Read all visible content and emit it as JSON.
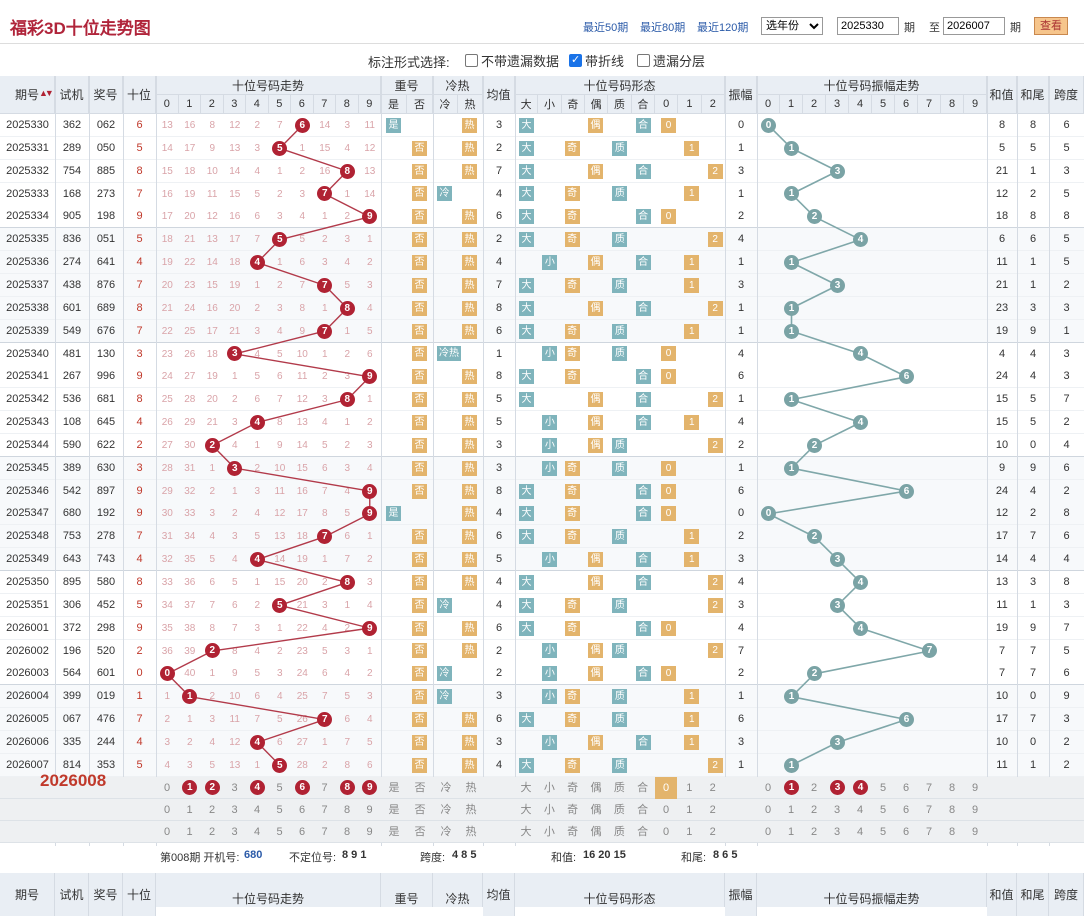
{
  "title": "福彩3D十位走势图",
  "quick_links": [
    "最近50期",
    "最近80期",
    "最近120期"
  ],
  "year_select": "选年份",
  "range": {
    "from": "2025330",
    "period_label": "期",
    "to_label": "至",
    "to": "2026007",
    "period_label2": "期"
  },
  "query_btn": "查看",
  "options": {
    "label": "标注形式选择:",
    "items": [
      {
        "label": "不带遗漏数据",
        "checked": false
      },
      {
        "label": "带折线",
        "checked": true
      },
      {
        "label": "遗漏分层",
        "checked": false
      }
    ]
  },
  "headers": {
    "period": "期号",
    "sort_icon": "sort-icon",
    "trial": "试机",
    "prize": "奖号",
    "tens": "十位",
    "trend": "十位号码走势",
    "repeat": "重号",
    "hotcold": "冷热",
    "avg": "均值",
    "shape": "十位号码形态",
    "amp": "振幅",
    "amptrend": "十位号码振幅走势",
    "sum": "和值",
    "sumtail": "和尾",
    "span": "跨度",
    "digits": [
      "0",
      "1",
      "2",
      "3",
      "4",
      "5",
      "6",
      "7",
      "8",
      "9"
    ],
    "repeat_sub": [
      "是",
      "否"
    ],
    "hotcold_sub": [
      "冷",
      "热"
    ],
    "shape_sub": [
      "大",
      "小",
      "奇",
      "偶",
      "质",
      "合",
      "0",
      "1",
      "2"
    ]
  },
  "rows": [
    {
      "p": "2025330",
      "t": "362",
      "z": "062",
      "d": 6,
      "tm": [
        13,
        16,
        8,
        12,
        2,
        7,
        0,
        14,
        3,
        11
      ],
      "rep": "是",
      "hc": "热",
      "av": 3,
      "big": "大",
      "bs": [
        0,
        2,
        7
      ],
      "oe": "偶",
      "oem": 7,
      "pc": "合",
      "pcm": 7,
      "r": "0",
      "rm": [
        0,
        2,
        3
      ],
      "amp": 0,
      "am": [
        0,
        6,
        1,
        7,
        2,
        2,
        14,
        11,
        10,
        24,
        55
      ],
      "sum": 8,
      "tail": 8,
      "span": 6
    },
    {
      "p": "2025331",
      "t": "289",
      "z": "050",
      "d": 5,
      "tm": [
        14,
        17,
        9,
        13,
        3,
        0,
        1,
        15,
        4,
        12
      ],
      "rep": "否",
      "hc": "热",
      "av": 2,
      "big": "大",
      "rz": "1",
      "amp": 1,
      "sum": 5,
      "tail": 5,
      "span": 5
    },
    {
      "p": "2025332",
      "t": "754",
      "z": "885",
      "d": 8,
      "tm": [
        15,
        18,
        10,
        14,
        4,
        1,
        2,
        16,
        0,
        13
      ],
      "rep": "否",
      "hc": "热",
      "av": 7,
      "big": "大",
      "rz": "2",
      "amp": 3,
      "sum": 21,
      "tail": 1,
      "span": 3
    },
    {
      "p": "2025333",
      "t": "168",
      "z": "273",
      "d": 7,
      "tm": [
        16,
        19,
        11,
        15,
        5,
        2,
        3,
        0,
        1,
        14
      ],
      "rep": "否",
      "hc": "冷",
      "av": 4,
      "big": "大",
      "rz": "1",
      "amp": 1,
      "sum": 12,
      "tail": 2,
      "span": 5
    },
    {
      "p": "2025334",
      "t": "905",
      "z": "198",
      "d": 9,
      "tm": [
        17,
        20,
        12,
        16,
        6,
        3,
        4,
        1,
        2,
        0
      ],
      "rep": "否",
      "hc": "热",
      "av": 6,
      "big": "大",
      "rz": "0",
      "amp": 2,
      "sum": 18,
      "tail": 8,
      "span": 8
    },
    {
      "p": "2025335",
      "t": "836",
      "z": "051",
      "d": 5,
      "tm": [
        18,
        21,
        13,
        17,
        7,
        0,
        5,
        2,
        3,
        1
      ],
      "rep": "否",
      "hc": "热",
      "av": 2,
      "big": "大",
      "rz": "2",
      "amp": 4,
      "sum": 6,
      "tail": 6,
      "span": 5
    },
    {
      "p": "2025336",
      "t": "274",
      "z": "641",
      "d": 4,
      "tm": [
        19,
        22,
        14,
        18,
        0,
        1,
        6,
        3,
        4,
        2
      ],
      "rep": "否",
      "hc": "热",
      "av": 4,
      "big": "小",
      "rz": "1",
      "amp": 1,
      "sum": 11,
      "tail": 1,
      "span": 5
    },
    {
      "p": "2025337",
      "t": "438",
      "z": "876",
      "d": 7,
      "tm": [
        20,
        23,
        15,
        19,
        1,
        2,
        7,
        0,
        5,
        3
      ],
      "rep": "否",
      "hc": "热",
      "av": 7,
      "big": "大",
      "rz": "1",
      "amp": 3,
      "sum": 21,
      "tail": 1,
      "span": 2
    },
    {
      "p": "2025338",
      "t": "601",
      "z": "689",
      "d": 8,
      "tm": [
        21,
        24,
        16,
        20,
        2,
        3,
        8,
        1,
        0,
        4
      ],
      "rep": "否",
      "hc": "热",
      "av": 8,
      "big": "大",
      "rz": "2",
      "amp": 1,
      "sum": 23,
      "tail": 3,
      "span": 3
    },
    {
      "p": "2025339",
      "t": "549",
      "z": "676",
      "d": 7,
      "tm": [
        22,
        25,
        17,
        21,
        3,
        4,
        9,
        0,
        1,
        5
      ],
      "rep": "否",
      "hc": "热",
      "av": 6,
      "big": "大",
      "rz": "1",
      "amp": 1,
      "sum": 19,
      "tail": 9,
      "span": 1
    },
    {
      "p": "2025340",
      "t": "481",
      "z": "130",
      "d": 3,
      "tm": [
        23,
        26,
        18,
        0,
        4,
        5,
        10,
        1,
        2,
        6
      ],
      "rep": "否",
      "hc": "冷热",
      "av": 1,
      "big": "小",
      "rz": "0",
      "amp": 4,
      "sum": 4,
      "tail": 4,
      "span": 3
    },
    {
      "p": "2025341",
      "t": "267",
      "z": "996",
      "d": 9,
      "tm": [
        24,
        27,
        19,
        1,
        5,
        6,
        11,
        2,
        3,
        0
      ],
      "rep": "否",
      "hc": "热",
      "av": 8,
      "big": "大",
      "rz": "0",
      "amp": 6,
      "sum": 24,
      "tail": 4,
      "span": 3
    },
    {
      "p": "2025342",
      "t": "536",
      "z": "681",
      "d": 8,
      "tm": [
        25,
        28,
        20,
        2,
        6,
        7,
        12,
        3,
        0,
        1
      ],
      "rep": "否",
      "hc": "热",
      "av": 5,
      "big": "大",
      "rz": "2",
      "amp": 1,
      "sum": 15,
      "tail": 5,
      "span": 7
    },
    {
      "p": "2025343",
      "t": "108",
      "z": "645",
      "d": 4,
      "tm": [
        26,
        29,
        21,
        3,
        0,
        8,
        13,
        4,
        1,
        2
      ],
      "rep": "否",
      "hc": "热",
      "av": 5,
      "big": "小",
      "rz": "1",
      "amp": 4,
      "sum": 15,
      "tail": 5,
      "span": 2
    },
    {
      "p": "2025344",
      "t": "590",
      "z": "622",
      "d": 2,
      "tm": [
        27,
        30,
        0,
        4,
        1,
        9,
        14,
        5,
        2,
        3
      ],
      "rep": "否",
      "hc": "热",
      "av": 3,
      "big": "小",
      "rz": "2",
      "amp": 2,
      "sum": 10,
      "tail": 0,
      "span": 4
    },
    {
      "p": "2025345",
      "t": "389",
      "z": "630",
      "d": 3,
      "tm": [
        28,
        31,
        1,
        0,
        2,
        10,
        15,
        6,
        3,
        4
      ],
      "rep": "否",
      "hc": "热",
      "av": 3,
      "big": "小",
      "rz": "0",
      "amp": 1,
      "sum": 9,
      "tail": 9,
      "span": 6
    },
    {
      "p": "2025346",
      "t": "542",
      "z": "897",
      "d": 9,
      "tm": [
        29,
        32,
        2,
        1,
        3,
        11,
        16,
        7,
        4,
        0
      ],
      "rep": "否",
      "hc": "热",
      "av": 8,
      "big": "大",
      "rz": "0",
      "amp": 6,
      "sum": 24,
      "tail": 4,
      "span": 2
    },
    {
      "p": "2025347",
      "t": "680",
      "z": "192",
      "d": 9,
      "tm": [
        30,
        33,
        3,
        2,
        4,
        12,
        17,
        8,
        5,
        0
      ],
      "rep": "是",
      "hc": "热",
      "av": 4,
      "big": "大",
      "rz": "0",
      "amp": 0,
      "sum": 12,
      "tail": 2,
      "span": 8
    },
    {
      "p": "2025348",
      "t": "753",
      "z": "278",
      "d": 7,
      "tm": [
        31,
        34,
        4,
        3,
        5,
        13,
        18,
        0,
        6,
        1
      ],
      "rep": "否",
      "hc": "热",
      "av": 6,
      "big": "大",
      "rz": "1",
      "amp": 2,
      "sum": 17,
      "tail": 7,
      "span": 6
    },
    {
      "p": "2025349",
      "t": "643",
      "z": "743",
      "d": 4,
      "tm": [
        32,
        35,
        5,
        4,
        0,
        14,
        19,
        1,
        7,
        2
      ],
      "rep": "否",
      "hc": "热",
      "av": 5,
      "big": "小",
      "rz": "1",
      "amp": 3,
      "sum": 14,
      "tail": 4,
      "span": 4
    },
    {
      "p": "2025350",
      "t": "895",
      "z": "580",
      "d": 8,
      "tm": [
        33,
        36,
        6,
        5,
        1,
        15,
        20,
        2,
        0,
        3
      ],
      "rep": "否",
      "hc": "热",
      "av": 4,
      "big": "大",
      "rz": "2",
      "amp": 4,
      "sum": 13,
      "tail": 3,
      "span": 8
    },
    {
      "p": "2025351",
      "t": "306",
      "z": "452",
      "d": 5,
      "tm": [
        34,
        37,
        7,
        6,
        2,
        0,
        21,
        3,
        1,
        4
      ],
      "rep": "否",
      "hc": "冷",
      "av": 4,
      "big": "大",
      "rz": "2",
      "amp": 3,
      "sum": 11,
      "tail": 1,
      "span": 3
    },
    {
      "p": "2026001",
      "t": "372",
      "z": "298",
      "d": 9,
      "tm": [
        35,
        38,
        8,
        7,
        3,
        1,
        22,
        4,
        2,
        0
      ],
      "rep": "否",
      "hc": "热",
      "av": 6,
      "big": "大",
      "rz": "0",
      "amp": 4,
      "sum": 19,
      "tail": 9,
      "span": 7
    },
    {
      "p": "2026002",
      "t": "196",
      "z": "520",
      "d": 2,
      "tm": [
        36,
        39,
        0,
        8,
        4,
        2,
        23,
        5,
        3,
        1
      ],
      "rep": "否",
      "hc": "热",
      "av": 2,
      "big": "小",
      "rz": "2",
      "amp": 7,
      "sum": 7,
      "tail": 7,
      "span": 5
    },
    {
      "p": "2026003",
      "t": "564",
      "z": "601",
      "d": 0,
      "tm": [
        0,
        40,
        1,
        9,
        5,
        3,
        24,
        6,
        4,
        2
      ],
      "rep": "否",
      "hc": "冷",
      "av": 2,
      "big": "小",
      "rz": "0",
      "amp": 2,
      "sum": 7,
      "tail": 7,
      "span": 6
    },
    {
      "p": "2026004",
      "t": "399",
      "z": "019",
      "d": 1,
      "tm": [
        1,
        0,
        2,
        10,
        6,
        4,
        25,
        7,
        5,
        3
      ],
      "rep": "否",
      "hc": "冷",
      "av": 3,
      "big": "小",
      "rz": "1",
      "amp": 1,
      "sum": 10,
      "tail": 0,
      "span": 9
    },
    {
      "p": "2026005",
      "t": "067",
      "z": "476",
      "d": 7,
      "tm": [
        2,
        1,
        3,
        11,
        7,
        5,
        26,
        0,
        6,
        4
      ],
      "rep": "否",
      "hc": "热",
      "av": 6,
      "big": "大",
      "rz": "1",
      "amp": 6,
      "sum": 17,
      "tail": 7,
      "span": 3
    },
    {
      "p": "2026006",
      "t": "335",
      "z": "244",
      "d": 4,
      "tm": [
        3,
        2,
        4,
        12,
        0,
        6,
        27,
        1,
        7,
        5
      ],
      "rep": "否",
      "hc": "热",
      "av": 3,
      "big": "小",
      "rz": "1",
      "amp": 3,
      "sum": 10,
      "tail": 0,
      "span": 2
    },
    {
      "p": "2026007",
      "t": "814",
      "z": "353",
      "d": 5,
      "tm": [
        4,
        3,
        5,
        13,
        1,
        0,
        28,
        2,
        8,
        6
      ],
      "rep": "否",
      "hc": "热",
      "av": 4,
      "big": "大",
      "rz": "2",
      "amp": 1,
      "sum": 11,
      "tail": 1,
      "span": 2
    }
  ],
  "predict": {
    "label": "2026008",
    "picked_tens": [
      1,
      2,
      4,
      6,
      8,
      9
    ],
    "shape_r": "0",
    "amp_picked": [
      1,
      3,
      4
    ]
  },
  "footer": {
    "issue": "第008期 开机号:",
    "open": "680",
    "nopos": "不定位号:",
    "nopos_v": "8 9 1",
    "span": "跨度:",
    "span_v": "4 8 5",
    "sum": "和值:",
    "sum_v": "16 20 15",
    "tail": "和尾:",
    "tail_v": "8 6 5"
  }
}
